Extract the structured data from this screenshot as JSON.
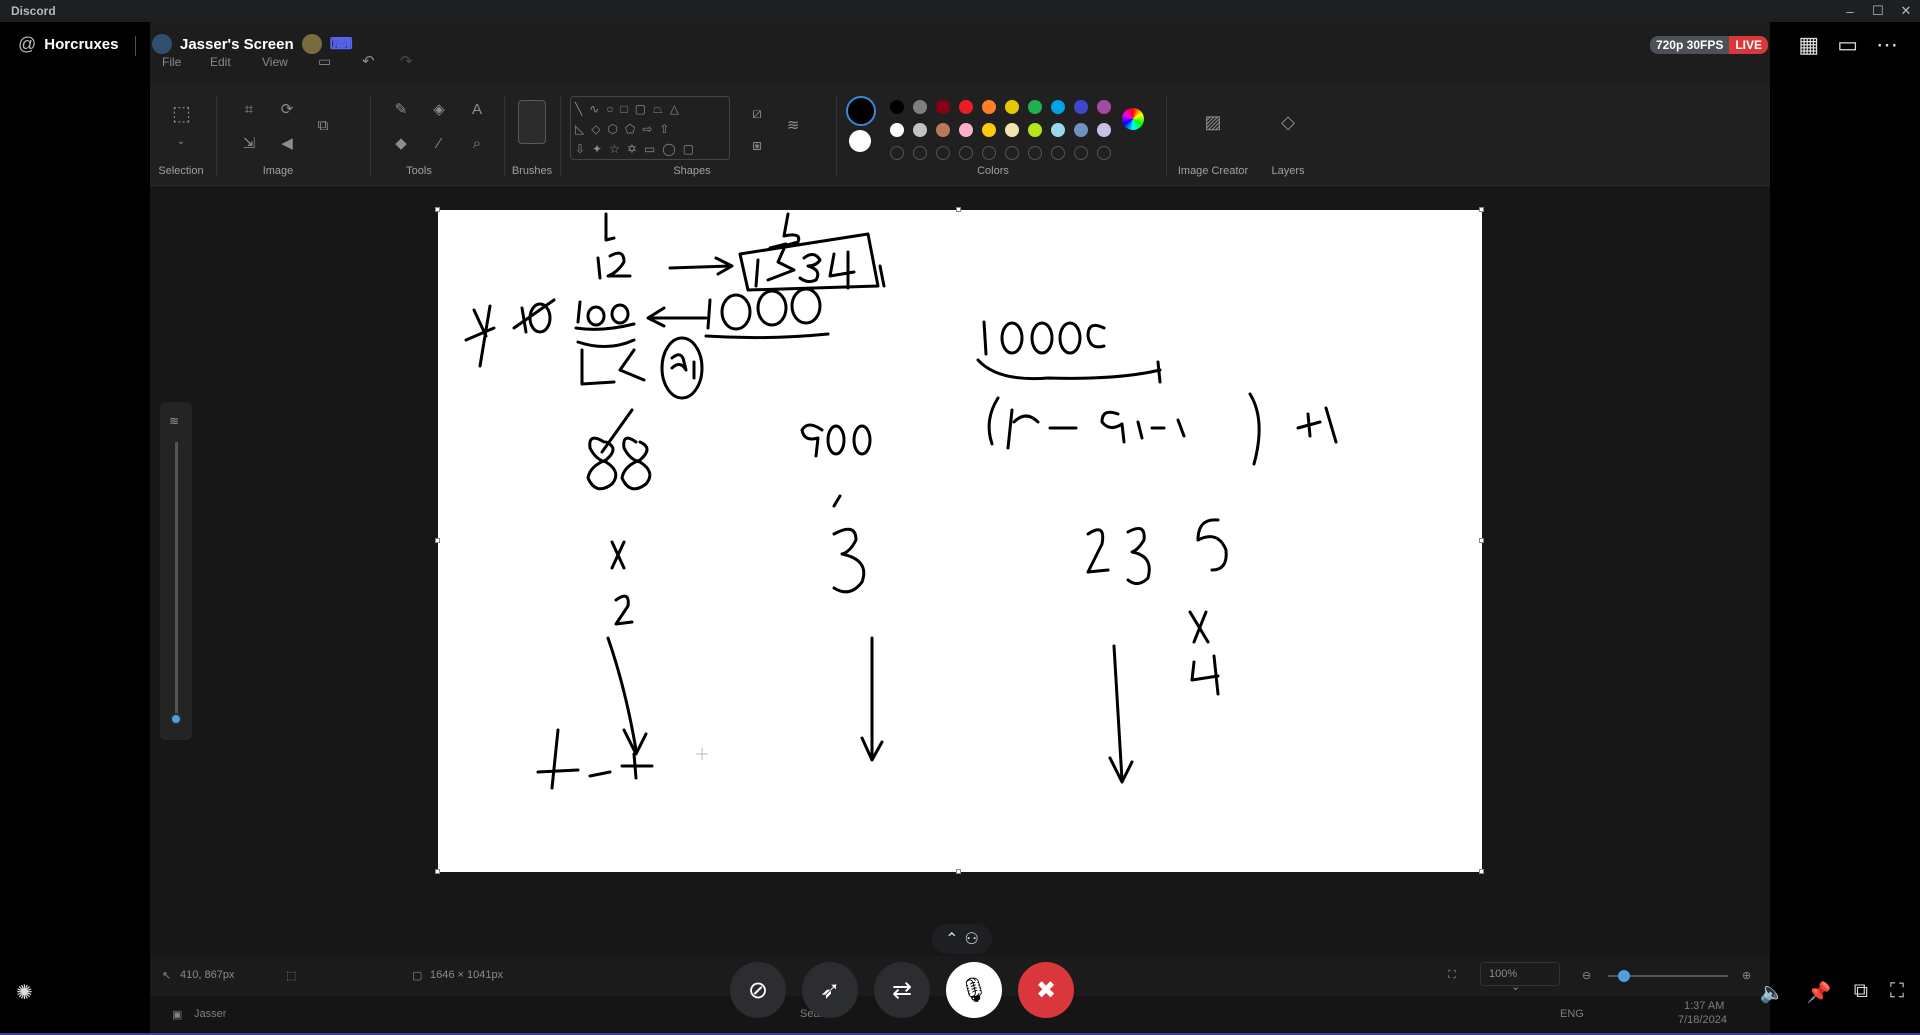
{
  "window": {
    "app_name": "Discord",
    "minimize": "–",
    "maximize": "☐",
    "close": "✕"
  },
  "header": {
    "channel": "Horcruxes",
    "stream_title": "Jasser's Screen",
    "quality": "720p 30FPS",
    "live": "LIVE"
  },
  "paint": {
    "menu": {
      "file": "File",
      "edit": "Edit",
      "view": "View"
    },
    "groups": {
      "selection": "Selection",
      "image": "Image",
      "tools": "Tools",
      "brushes": "Brushes",
      "shapes": "Shapes",
      "colors": "Colors",
      "image_creator": "Image Creator",
      "layers": "Layers"
    },
    "palette_row1": [
      "#000000",
      "#7f7f7f",
      "#880015",
      "#ed1c24",
      "#ff7f27",
      "#e5c800",
      "#22b14c",
      "#00a2e8",
      "#3f48cc",
      "#a349a4"
    ],
    "palette_row2": [
      "#ffffff",
      "#c3c3c3",
      "#b97a57",
      "#ffaec9",
      "#ffc90e",
      "#efe4b0",
      "#b5e61d",
      "#99d9ea",
      "#7092be",
      "#c8bfe7"
    ],
    "status": {
      "cursor_pos": "410, 867px",
      "canvas_size": "1646 × 1041px",
      "zoom": "100%"
    },
    "taskbar": {
      "user": "Jasser",
      "search": "Search",
      "lang": "ENG",
      "time": "1:37 AM",
      "date": "7/18/2024"
    }
  }
}
